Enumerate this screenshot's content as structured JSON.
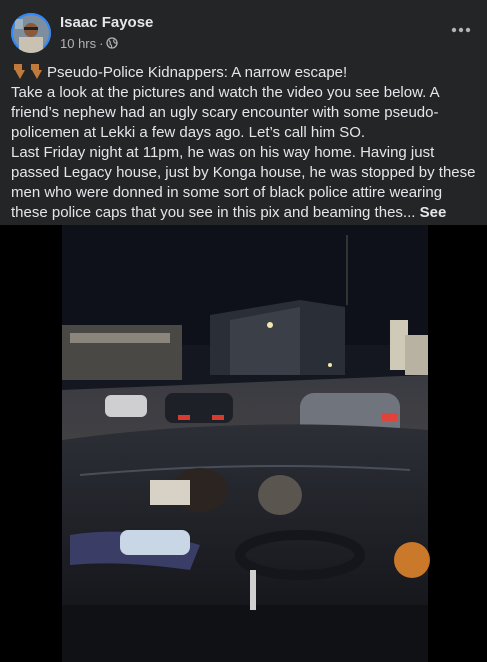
{
  "post": {
    "author": "Isaac Fayose",
    "time": "10 hrs",
    "separator": "·",
    "privacy_icon": "globe-icon",
    "more_icon": "more-options-icon",
    "text": {
      "emoji": "👇👇",
      "line1": "Pseudo-Police Kidnappers: A narrow escape!",
      "para1": "Take a look at the pictures and watch the video you see below. A friend’s nephew had an ugly scary encounter with some pseudo-policemen at Lekki a few days ago. Let’s call him SO.",
      "para2": "Last Friday night at 11pm, he was on his way home. Having just passed Legacy house, just by Konga house, he was stopped by these men who were donned in some sort of black police attire wearing these police caps that you see in this pix and beaming thes...",
      "see_more": "See More"
    }
  },
  "media": {
    "type": "video",
    "description_icon": "video-frame"
  },
  "colors": {
    "background": "#242526",
    "text_primary": "#e4e6eb",
    "text_secondary": "#b0b3b8"
  }
}
